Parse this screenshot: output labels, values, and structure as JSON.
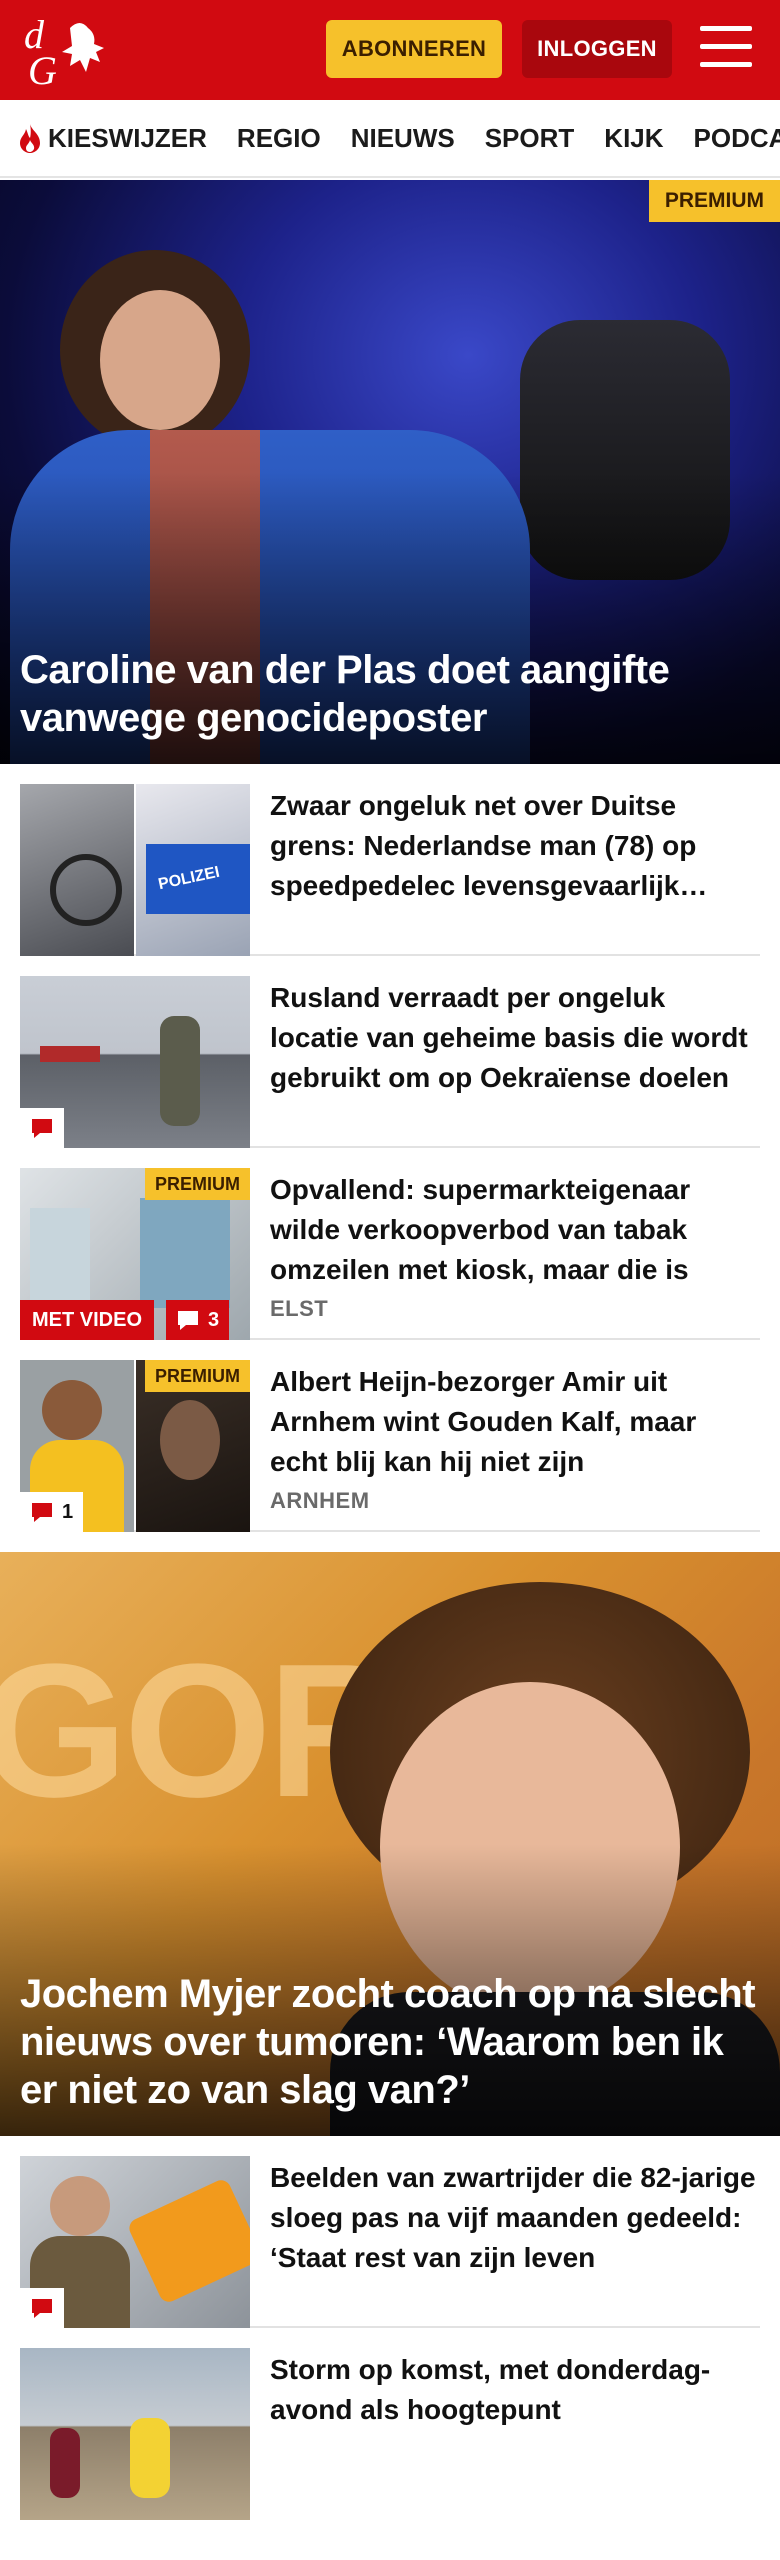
{
  "header": {
    "logo_text": "dG",
    "subscribe_label": "ABONNEREN",
    "login_label": "INLOGGEN",
    "brand_color": "#d10a11",
    "accent_color": "#f6c12b"
  },
  "nav": {
    "items": [
      {
        "label": "KIESWIJZER",
        "icon": "flame-icon"
      },
      {
        "label": "REGIO"
      },
      {
        "label": "NIEUWS"
      },
      {
        "label": "SPORT"
      },
      {
        "label": "KIJK"
      },
      {
        "label": "PODCASTS"
      }
    ]
  },
  "hero1": {
    "badge": "PREMIUM",
    "title": "Caroline van der Plas doet aangifte vanwege genocideposter"
  },
  "articles1": [
    {
      "title": "Zwaar ongeluk net over Duitse grens: Nederlandse man (78) op speedpedelec levensgevaarlijk gewond"
    },
    {
      "title": "Rusland verraadt per ongeluk locatie van geheime basis die wordt gebruikt om op Oekraïense doelen",
      "comments_icon": "comment-icon"
    },
    {
      "title": "Opvallend: supermarkteigenaar wilde verkoopverbod van tabak omzeilen met kiosk, maar die is",
      "location": "ELST",
      "premium": "PREMIUM",
      "video": "MET VIDEO",
      "comments": "3"
    },
    {
      "title": "Albert Heijn-bezorger Amir uit Arnhem wint Gouden Kalf, maar echt blij kan hij niet zijn",
      "location": "ARNHEM",
      "premium": "PREMIUM",
      "comments": "1"
    }
  ],
  "hero2": {
    "title": "Jochem Myjer zocht coach op na slecht nieuws over tumoren: ‘Waarom ben ik er niet zo van slag van?’"
  },
  "articles2": [
    {
      "title": "Beelden van zwartrijder die 82-jarige sloeg pas na vijf maanden gedeeld: ‘Staat rest van zijn leven",
      "comments_icon": "comment-icon"
    },
    {
      "title": "Storm op komst, met donderdag-avond als hoogtepunt"
    }
  ]
}
